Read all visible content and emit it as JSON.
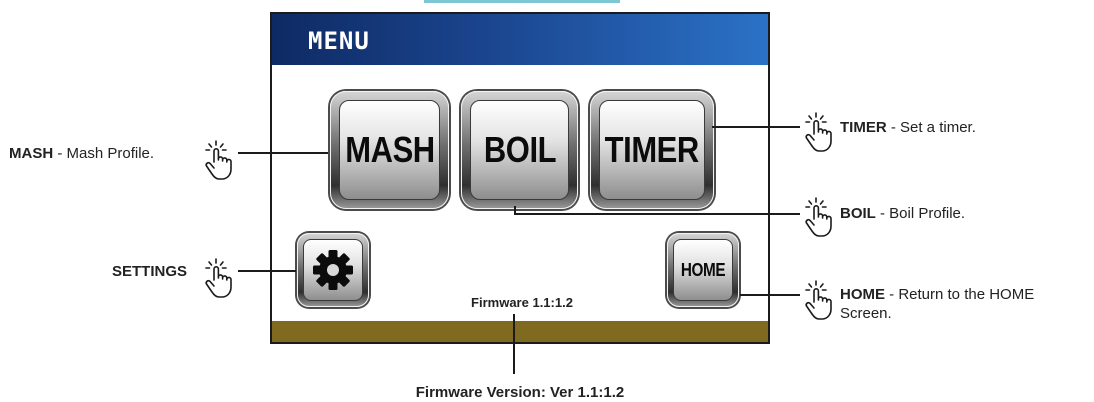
{
  "screen": {
    "title": "MENU",
    "buttons": {
      "mash": "MASH",
      "boil": "BOIL",
      "timer": "TIMER",
      "home": "HOME"
    },
    "firmware": "Firmware 1.1:1.2",
    "colors": {
      "header": "#1b4690",
      "footer": "#7f6a1f"
    }
  },
  "annotations": {
    "mash": {
      "title": "MASH",
      "desc": " - Mash Profile."
    },
    "settings": {
      "title": "SETTINGS",
      "desc": ""
    },
    "timer": {
      "title": "TIMER",
      "desc": " - Set a timer."
    },
    "boil": {
      "title": "BOIL",
      "desc": " - Boil Profile."
    },
    "home": {
      "title": "HOME",
      "desc": " - Return to the HOME",
      "desc2": "Screen."
    },
    "firmware_version": "Firmware Version: Ver 1.1:1.2"
  },
  "icons": [
    "tap-hand-icon",
    "gear-icon"
  ]
}
